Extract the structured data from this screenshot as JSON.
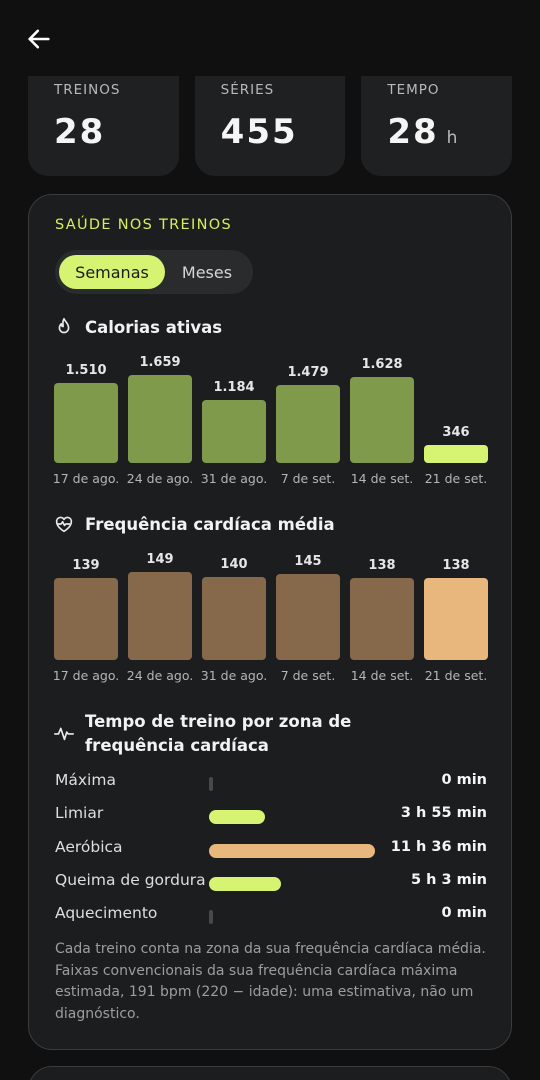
{
  "header": {
    "back_icon": "arrow-left-icon"
  },
  "stats": [
    {
      "label": "TREINOS",
      "value": "28",
      "unit": ""
    },
    {
      "label": "SÉRIES",
      "value": "455",
      "unit": ""
    },
    {
      "label": "TEMPO",
      "value": "28",
      "unit": "h"
    }
  ],
  "health": {
    "title": "SAÚDE NOS TREINOS",
    "toggle": {
      "active": "Semanas",
      "inactive": "Meses"
    },
    "calories": {
      "title": "Calorias ativas",
      "icon": "flame-icon"
    },
    "heart_rate": {
      "title": "Frequência cardíaca média",
      "icon": "heart-pulse-icon"
    },
    "zones": {
      "title": "Tempo de treino por zona de frequência cardíaca",
      "icon": "pulse-line-icon",
      "items": [
        {
          "name": "Máxima",
          "value": "0 min",
          "minutes": 0,
          "color": "#48494b"
        },
        {
          "name": "Limiar",
          "value": "3 h 55 min",
          "minutes": 235,
          "color": "#d6f372"
        },
        {
          "name": "Aeróbica",
          "value": "11 h 36 min",
          "minutes": 696,
          "color": "#e8b77e"
        },
        {
          "name": "Queima de gordura",
          "value": "5 h 3 min",
          "minutes": 303,
          "color": "#d6f372"
        },
        {
          "name": "Aquecimento",
          "value": "0 min",
          "minutes": 0,
          "color": "#48494b"
        }
      ]
    },
    "note": "Cada treino conta na zona da sua frequência cardíaca média. Faixas convencionais da sua frequência cardíaca máxima estimada, 191 bpm (220 − idade): uma estimativa, não um diagnóstico."
  },
  "chart_data": [
    {
      "type": "bar",
      "title": "Calorias ativas",
      "categories": [
        "17 de ago.",
        "24 de ago.",
        "31 de ago.",
        "7 de set.",
        "14 de set.",
        "21 de set."
      ],
      "values": [
        1510,
        1659,
        1184,
        1479,
        1628,
        346
      ],
      "value_labels": [
        "1.510",
        "1.659",
        "1.184",
        "1.479",
        "1.628",
        "346"
      ],
      "colors": [
        "#7e9a4a",
        "#7e9a4a",
        "#7e9a4a",
        "#7e9a4a",
        "#7e9a4a",
        "#d6f372"
      ],
      "ylim": [
        0,
        1659
      ]
    },
    {
      "type": "bar",
      "title": "Frequência cardíaca média",
      "categories": [
        "17 de ago.",
        "24 de ago.",
        "31 de ago.",
        "7 de set.",
        "14 de set.",
        "21 de set."
      ],
      "values": [
        139,
        149,
        140,
        145,
        138,
        138
      ],
      "value_labels": [
        "139",
        "149",
        "140",
        "145",
        "138",
        "138"
      ],
      "colors": [
        "#85694a",
        "#85694a",
        "#85694a",
        "#85694a",
        "#85694a",
        "#e8b77e"
      ],
      "ylim": [
        0,
        149
      ]
    }
  ]
}
